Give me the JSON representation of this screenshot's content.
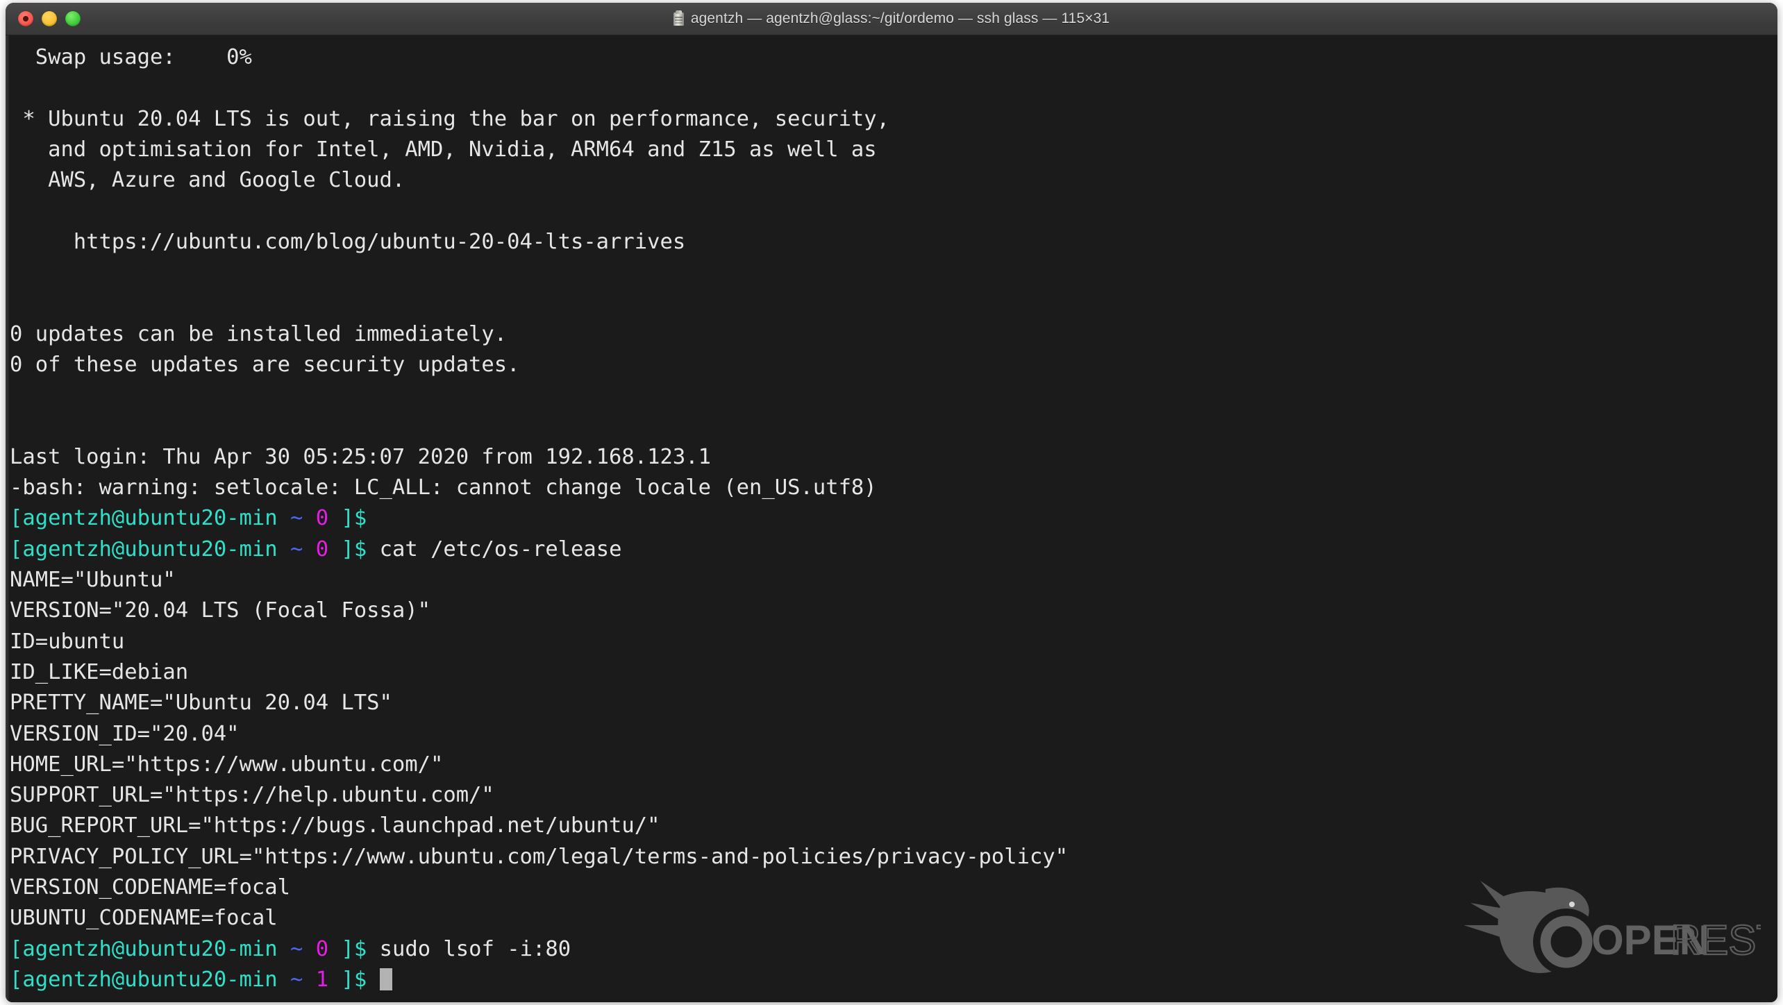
{
  "window": {
    "title": "agentzh — agentzh@glass:~/git/ordemo — ssh glass — 115×31",
    "icon": "terminal-door-icon",
    "traffic_lights": {
      "close": "close-button",
      "minimize": "minimize-button",
      "maximize": "maximize-button"
    },
    "colors": {
      "close": "#f9564a",
      "minimize": "#f7c130",
      "maximize": "#3cc93a",
      "titlebar_bg": "#3d3d3d",
      "terminal_bg": "#1b1b1b",
      "foreground": "#e6e6e6",
      "prompt_cyan": "#2ee0c8",
      "prompt_blue": "#4d68f0",
      "prompt_magenta": "#e21ee2",
      "cursor": "#b3b3b3"
    }
  },
  "terminal": {
    "columns": 115,
    "rows": 31,
    "lines": [
      {
        "text": "  Swap usage:    0%"
      },
      {
        "text": ""
      },
      {
        "text": " * Ubuntu 20.04 LTS is out, raising the bar on performance, security,"
      },
      {
        "text": "   and optimisation for Intel, AMD, Nvidia, ARM64 and Z15 as well as"
      },
      {
        "text": "   AWS, Azure and Google Cloud."
      },
      {
        "text": ""
      },
      {
        "text": "     https://ubuntu.com/blog/ubuntu-20-04-lts-arrives"
      },
      {
        "text": ""
      },
      {
        "text": ""
      },
      {
        "text": "0 updates can be installed immediately."
      },
      {
        "text": "0 of these updates are security updates."
      },
      {
        "text": ""
      },
      {
        "text": ""
      },
      {
        "text": "Last login: Thu Apr 30 05:25:07 2020 from 192.168.123.1"
      },
      {
        "text": "-bash: warning: setlocale: LC_ALL: cannot change locale (en_US.utf8)"
      }
    ],
    "prompt_lines": [
      {
        "bracket_open": "[",
        "userhost": "agentzh@ubuntu20-min",
        "path": "~",
        "status": "0",
        "bracket_close": "]$",
        "command": ""
      },
      {
        "bracket_open": "[",
        "userhost": "agentzh@ubuntu20-min",
        "path": "~",
        "status": "0",
        "bracket_close": "]$",
        "command": " cat /etc/os-release"
      }
    ],
    "os_release": [
      "NAME=\"Ubuntu\"",
      "VERSION=\"20.04 LTS (Focal Fossa)\"",
      "ID=ubuntu",
      "ID_LIKE=debian",
      "PRETTY_NAME=\"Ubuntu 20.04 LTS\"",
      "VERSION_ID=\"20.04\"",
      "HOME_URL=\"https://www.ubuntu.com/\"",
      "SUPPORT_URL=\"https://help.ubuntu.com/\"",
      "BUG_REPORT_URL=\"https://bugs.launchpad.net/ubuntu/\"",
      "PRIVACY_POLICY_URL=\"https://www.ubuntu.com/legal/terms-and-policies/privacy-policy\"",
      "VERSION_CODENAME=focal",
      "UBUNTU_CODENAME=focal"
    ],
    "tail_prompt_lines": [
      {
        "bracket_open": "[",
        "userhost": "agentzh@ubuntu20-min",
        "path": "~",
        "status": "0",
        "bracket_close": "]$",
        "command": " sudo lsof -i:80"
      },
      {
        "bracket_open": "[",
        "userhost": "agentzh@ubuntu20-min",
        "path": "~",
        "status": "1",
        "bracket_close": "]$",
        "command": " "
      }
    ]
  },
  "watermark": {
    "text_bold": "OPEN",
    "text_outline": "RESTY",
    "logo": "openresty-bird-logo",
    "color": "#5a5a5a"
  }
}
